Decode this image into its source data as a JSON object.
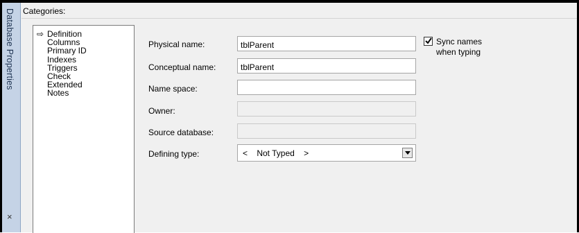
{
  "side_panel": {
    "title": "Database Properties",
    "close_glyph": "×"
  },
  "categories": {
    "header": "Categories:",
    "selected_marker": "⇨",
    "items": [
      {
        "label": "Definition",
        "selected": true
      },
      {
        "label": "Columns"
      },
      {
        "label": "Primary ID"
      },
      {
        "label": "Indexes"
      },
      {
        "label": "Triggers"
      },
      {
        "label": "Check"
      },
      {
        "label": "Extended"
      },
      {
        "label": "Notes"
      }
    ]
  },
  "form": {
    "physical_name": {
      "label": "Physical name:",
      "value": "tblParent"
    },
    "conceptual_name": {
      "label": "Conceptual name:",
      "value": "tblParent"
    },
    "name_space": {
      "label": "Name space:",
      "value": ""
    },
    "owner": {
      "label": "Owner:",
      "value": ""
    },
    "source_database": {
      "label": "Source database:",
      "value": ""
    },
    "defining_type": {
      "label": "Defining type:",
      "value": "<    Not Typed    >"
    }
  },
  "sync_names": {
    "label_line1": "Sync names",
    "label_line2": "when typing",
    "checked": true
  }
}
